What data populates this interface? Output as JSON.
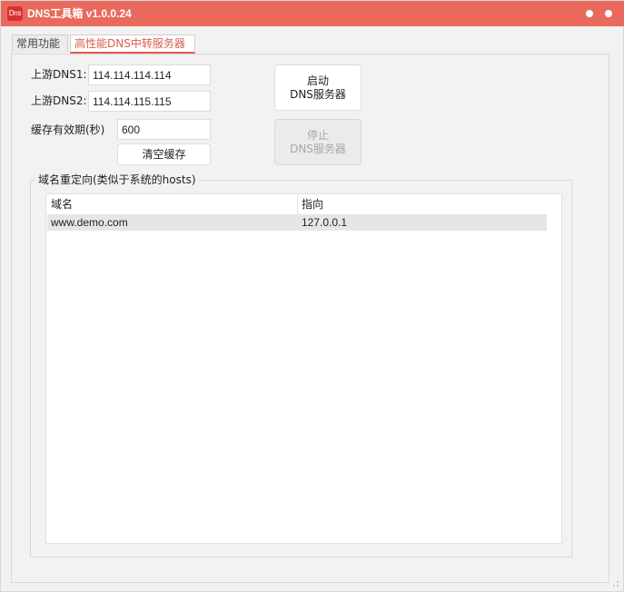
{
  "window": {
    "title": "DNS工具箱 v1.0.0.24",
    "app_icon_text": "Dns",
    "title_color": "#e96a5d"
  },
  "tabs": [
    {
      "label": "常用功能",
      "active": false
    },
    {
      "label": "高性能DNS中转服务器",
      "active": true
    }
  ],
  "dns": {
    "upstream1_label": "上游DNS1:",
    "upstream1_value": "114.114.114.114",
    "upstream2_label": "上游DNS2:",
    "upstream2_value": "114.114.115.115",
    "cache_label": "缓存有效期(秒)",
    "cache_value": "600",
    "clear_cache_label": "清空缓存"
  },
  "server_buttons": {
    "start_line1": "启动",
    "start_line2": "DNS服务器",
    "stop_line1": "停止",
    "stop_line2": "DNS服务器",
    "stop_enabled": false
  },
  "redirect": {
    "group_title": "域名重定向(类似于系统的hosts)",
    "columns": [
      "域名",
      "指向"
    ],
    "rows": [
      {
        "domain": "www.demo.com",
        "target": "127.0.0.1",
        "selected": true
      }
    ]
  }
}
